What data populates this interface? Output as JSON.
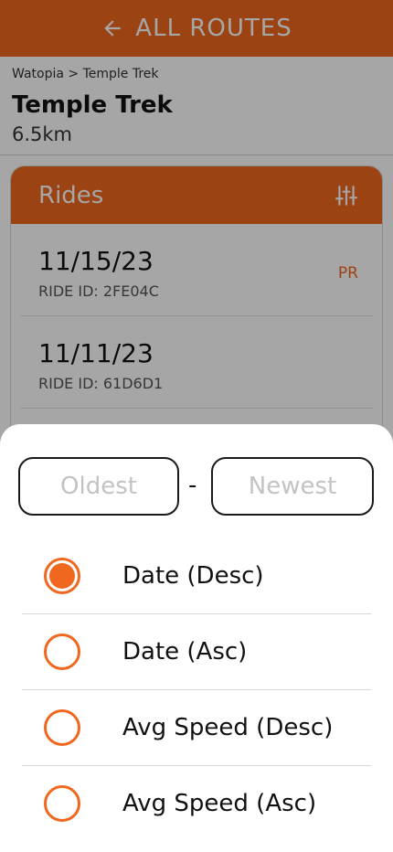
{
  "header": {
    "back_icon": "arrow-left-icon",
    "title": "ALL ROUTES"
  },
  "route": {
    "breadcrumb": "Watopia > Temple Trek",
    "name": "Temple Trek",
    "distance": "6.5km"
  },
  "rides": {
    "title": "Rides",
    "filter_icon": "sliders-icon",
    "items": [
      {
        "date": "11/15/23",
        "ride_id": "RIDE ID: 2FE04C",
        "badge": "PR"
      },
      {
        "date": "11/11/23",
        "ride_id": "RIDE ID: 61D6D1",
        "badge": ""
      }
    ]
  },
  "sheet": {
    "range_start_placeholder": "Oldest",
    "range_separator": "-",
    "range_end_placeholder": "Newest",
    "sort_options": [
      {
        "label": "Date (Desc)",
        "selected": true
      },
      {
        "label": "Date (Asc)",
        "selected": false
      },
      {
        "label": "Avg Speed (Desc)",
        "selected": false
      },
      {
        "label": "Avg Speed (Asc)",
        "selected": false
      }
    ]
  },
  "colors": {
    "accent": "#f0671f",
    "overlay": "rgba(0,0,0,0.35)"
  }
}
